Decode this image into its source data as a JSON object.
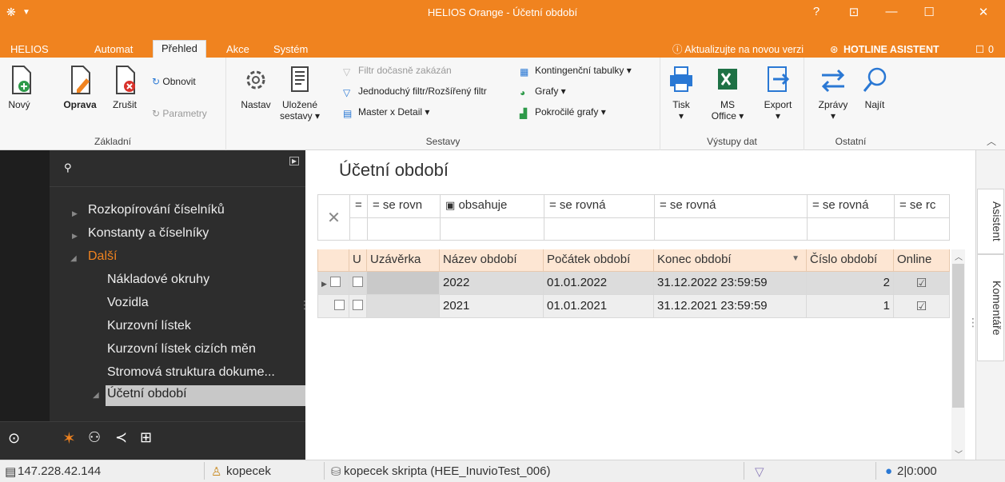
{
  "window": {
    "title": "HELIOS Orange - Účetní období",
    "help": "?",
    "restore_icon": "⊡",
    "minimize": "—",
    "maximize": "☐",
    "close": "✕"
  },
  "menu": {
    "tabs": [
      "HELIOS",
      "Automat",
      "Přehled",
      "Akce",
      "Systém"
    ],
    "active_tab": "Přehled",
    "update_notice": "ⓘ Aktualizujte na novou verzi",
    "hotline": "HOTLINE ASISTENT",
    "hotline_count": "0"
  },
  "ribbon": {
    "basic": {
      "label": "Základní",
      "new": "Nový",
      "edit": "Oprava",
      "cancel": "Zrušit",
      "refresh": "Obnovit",
      "params": "Parametry"
    },
    "reports": {
      "label": "Sestavy",
      "settings": "Nastav",
      "saved_1": "Uložené",
      "saved_2": "sestavy ▾",
      "filter_disabled": "Filtr dočasně zakázán",
      "simple_filter": "Jednoduchý filtr/Rozšířený filtr",
      "master_detail": "Master x Detail ▾",
      "pivot": "Kontingenční tabulky ▾",
      "charts": "Grafy ▾",
      "adv_charts": "Pokročilé grafy ▾"
    },
    "outputs": {
      "label": "Výstupy dat",
      "print": "Tisk",
      "print_arrow": "▾",
      "office_1": "MS",
      "office_2": "Office ▾",
      "export": "Export",
      "export_arrow": "▾"
    },
    "other": {
      "label": "Ostatní",
      "messages": "Zprávy",
      "messages_arrow": "▾",
      "find": "Najít"
    }
  },
  "nav": {
    "items": [
      {
        "label": "Rozkopírování číselníků"
      },
      {
        "label": "Konstanty a číselníky"
      },
      {
        "label": "Další"
      },
      {
        "label": "Nákladové okruhy"
      },
      {
        "label": "Vozidla"
      },
      {
        "label": "Kurzovní lístek"
      },
      {
        "label": "Kurzovní lístek cizích měn"
      },
      {
        "label": "Stromová struktura dokume..."
      },
      {
        "label": "Účetní období"
      }
    ]
  },
  "page": {
    "title": "Účetní období"
  },
  "filters": [
    "=",
    "= se rovn",
    "obsahuje",
    "= se rovná",
    "= se rovná",
    "= se rovná",
    "= se rc"
  ],
  "table": {
    "headers": [
      "U",
      "Uzávěrka",
      "Název období",
      "Počátek období",
      "Konec období",
      "Číslo období",
      "Online"
    ],
    "rows": [
      {
        "name": "2022",
        "start": "01.01.2022",
        "end": "31.12.2022 23:59:59",
        "number": "2"
      },
      {
        "name": "2021",
        "start": "01.01.2021",
        "end": "31.12.2021 23:59:59",
        "number": "1"
      }
    ]
  },
  "side_tabs": {
    "assistant": "Asistent",
    "comments": "Komentáře"
  },
  "status": {
    "ip": "147.228.42.144",
    "user": "kopecek",
    "db": "kopecek skripta (HEE_InuvioTest_006)",
    "count": "2|0:000"
  }
}
